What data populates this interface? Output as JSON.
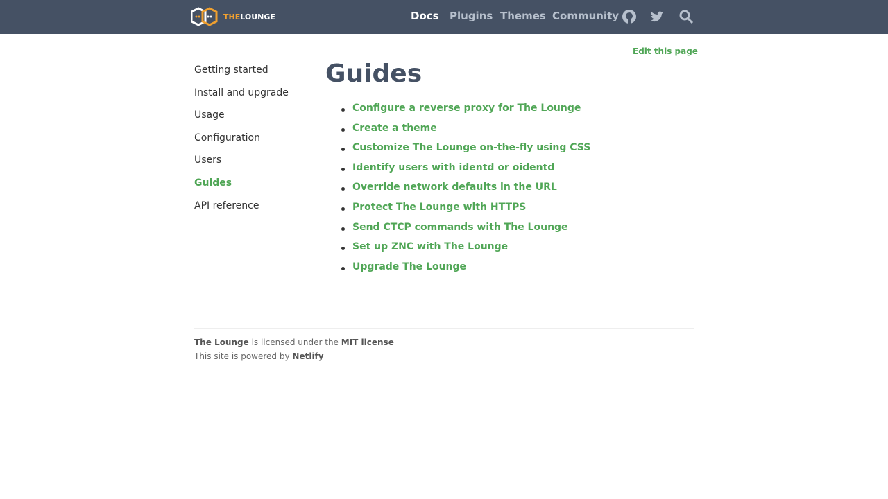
{
  "header": {
    "logo_the": "THE",
    "logo_lounge": "LOUNGE",
    "nav": [
      "Docs",
      "Plugins",
      "Themes",
      "Community"
    ]
  },
  "sidebar": [
    "Getting started",
    "Install and upgrade",
    "Usage",
    "Configuration",
    "Users",
    "Guides",
    "API reference"
  ],
  "main": {
    "title": "Guides",
    "edit": "Edit this page",
    "guides": [
      "Configure a reverse proxy for The Lounge",
      "Create a theme",
      "Customize The Lounge on-the-fly using CSS",
      "Identify users with identd or oidentd",
      "Override network defaults in the URL",
      "Protect The Lounge with HTTPS",
      "Send CTCP commands with The Lounge",
      "Set up ZNC with The Lounge",
      "Upgrade The Lounge"
    ]
  },
  "footer": {
    "l1a": "The Lounge",
    "l1b": " is licensed under the ",
    "l1c": "MIT license",
    "l2a": "This site is powered by ",
    "l2b": "Netlify"
  }
}
